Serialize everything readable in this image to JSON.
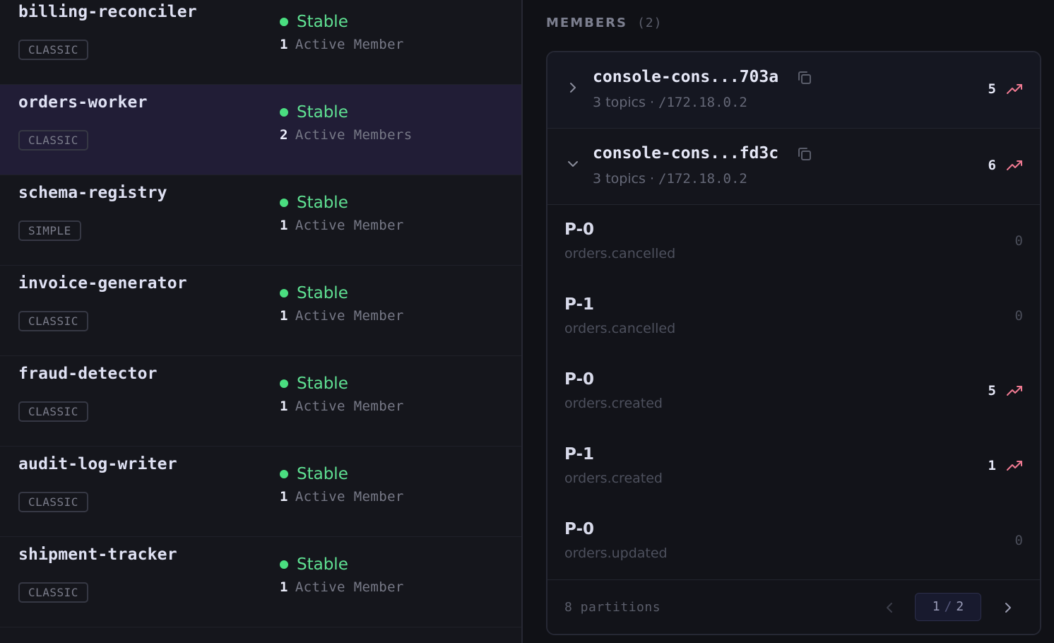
{
  "groups": [
    {
      "name": "billing-reconciler",
      "protocol": "CLASSIC",
      "status": "Stable",
      "member_count": "1",
      "member_label": "Active Member"
    },
    {
      "name": "orders-worker",
      "protocol": "CLASSIC",
      "status": "Stable",
      "member_count": "2",
      "member_label": "Active Members"
    },
    {
      "name": "schema-registry",
      "protocol": "SIMPLE",
      "status": "Stable",
      "member_count": "1",
      "member_label": "Active Member"
    },
    {
      "name": "invoice-generator",
      "protocol": "CLASSIC",
      "status": "Stable",
      "member_count": "1",
      "member_label": "Active Member"
    },
    {
      "name": "fraud-detector",
      "protocol": "CLASSIC",
      "status": "Stable",
      "member_count": "1",
      "member_label": "Active Member"
    },
    {
      "name": "audit-log-writer",
      "protocol": "CLASSIC",
      "status": "Stable",
      "member_count": "1",
      "member_label": "Active Member"
    },
    {
      "name": "shipment-tracker",
      "protocol": "CLASSIC",
      "status": "Stable",
      "member_count": "1",
      "member_label": "Active Member"
    }
  ],
  "selected_group": "orders-worker",
  "members_panel": {
    "title": "MEMBERS",
    "count": "(2)",
    "members": [
      {
        "id": "console-cons...703a",
        "topics": "3 topics",
        "sep": "·",
        "host": "/172.18.0.2",
        "lag": "5",
        "expanded": false
      },
      {
        "id": "console-cons...fd3c",
        "topics": "3 topics",
        "sep": "·",
        "host": "/172.18.0.2",
        "lag": "6",
        "expanded": true
      }
    ],
    "partitions": [
      {
        "name": "P-0",
        "topic": "orders.cancelled",
        "lag": "0"
      },
      {
        "name": "P-1",
        "topic": "orders.cancelled",
        "lag": "0"
      },
      {
        "name": "P-0",
        "topic": "orders.created",
        "lag": "5"
      },
      {
        "name": "P-1",
        "topic": "orders.created",
        "lag": "1"
      },
      {
        "name": "P-0",
        "topic": "orders.updated",
        "lag": "0"
      }
    ],
    "footer": {
      "partitions_label": "8 partitions",
      "page_current": "1",
      "page_sep": "/",
      "page_total": "2"
    }
  },
  "colors": {
    "status_stable": "#4ade80",
    "selected_row": "#211d36",
    "trend_up": "#f07a92"
  },
  "icons": {
    "copy": "copy-icon",
    "trend": "trending-up-icon",
    "expand": "chevron-right-icon",
    "collapse": "chevron-down-icon"
  }
}
